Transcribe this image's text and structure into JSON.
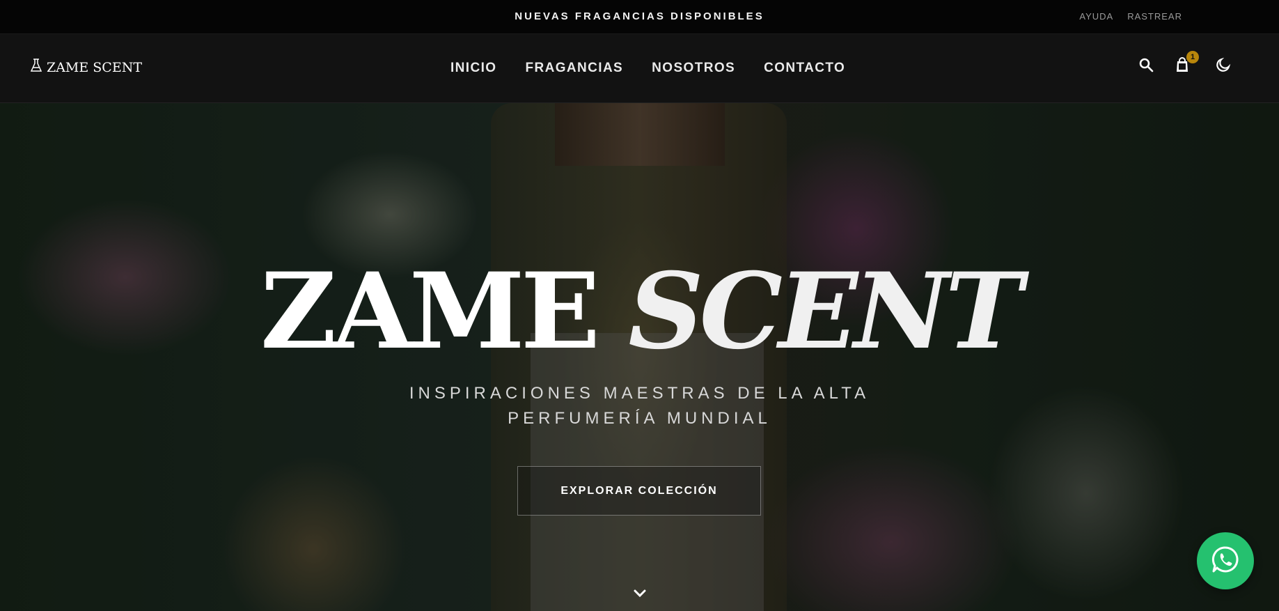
{
  "announcement": {
    "text": "NUEVAS FRAGANCIAS DISPONIBLES",
    "links": [
      "AYUDA",
      "RASTREAR"
    ]
  },
  "header": {
    "logo_text": "ZAME SCENT",
    "logo_icon": "flask-icon",
    "nav": [
      "INICIO",
      "FRAGANCIAS",
      "NOSOTROS",
      "CONTACTO"
    ],
    "icons": [
      "search-icon",
      "shopping-bag-icon",
      "moon-icon"
    ],
    "cart_count": "1",
    "badge_color": "#b8860b"
  },
  "hero": {
    "title_main": "ZAME",
    "title_italic": "SCENT",
    "subtitle_line1": "INSPIRACIONES MAESTRAS DE LA ALTA",
    "subtitle_line2": "PERFUMERÍA MUNDIAL",
    "cta_label": "EXPLORAR COLECCIÓN",
    "scroll_icon": "chevron-down-icon"
  },
  "floating": {
    "whatsapp_icon": "whatsapp-icon",
    "whatsapp_color": "#25c16f"
  }
}
